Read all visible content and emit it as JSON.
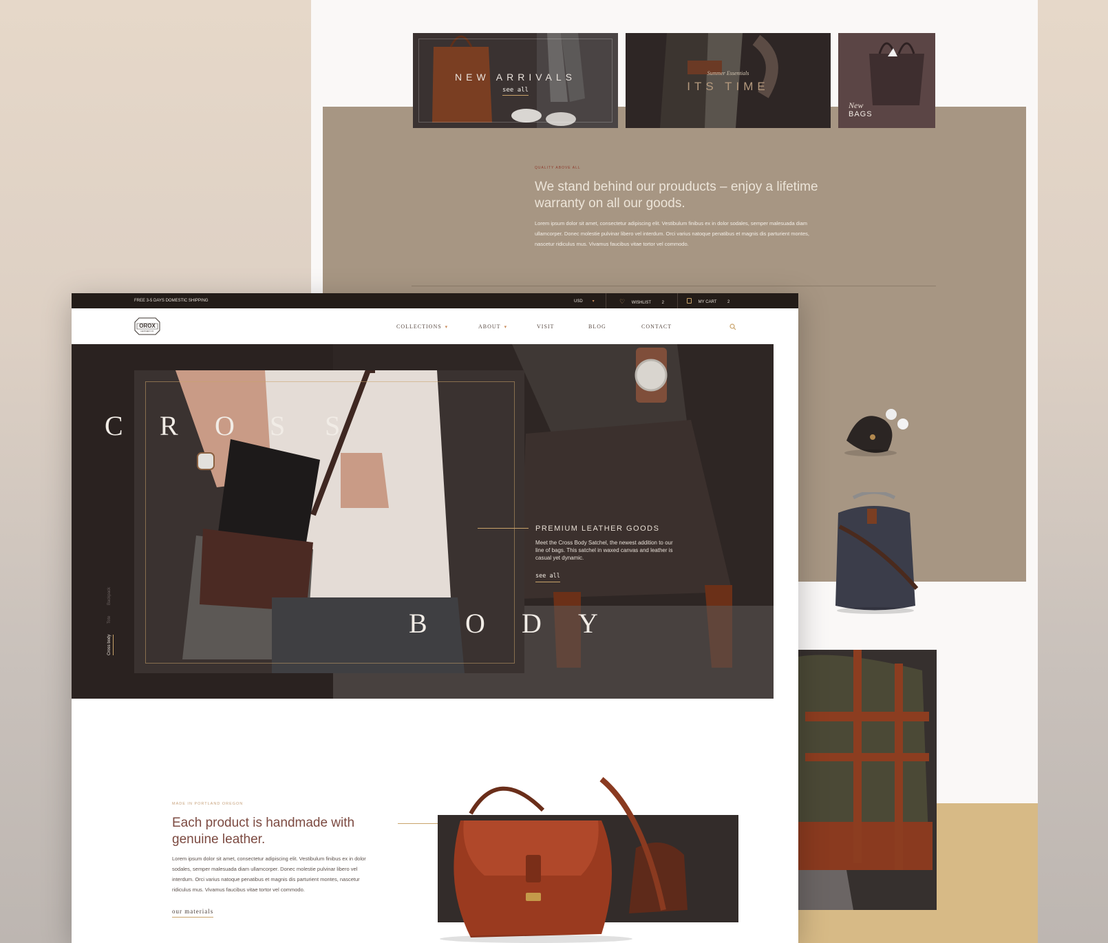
{
  "colors": {
    "accent_gold": "#c9a36a",
    "brand_dark": "#231c18",
    "band_taupe": "#a79683",
    "accent_brown": "#7c4a41"
  },
  "back_page": {
    "tiles": [
      {
        "title": "NEW ARRIVALS",
        "link": "see all"
      },
      {
        "kicker": "Summer Essentials",
        "title": "ITS TIME"
      },
      {
        "kicker": "New",
        "title": "BAGS"
      }
    ],
    "quality": {
      "eyebrow": "QUALITY ABOVE ALL",
      "title": "We stand behind our prouducts – enjoy a lifetime warranty on all our goods.",
      "body": "Lorem ipsum dolor sit amet, consectetur adipiscing elit. Vestibulum finibus ex in dolor sodales, semper malesuada diam ullamcorper. Donec molestie pulvinar libero vel interdum. Orci varius natoque penatibus et magnis dis parturient montes, nascetur ridiculus mus. Vivamus faucibus vitae tortor vel commodo."
    }
  },
  "topbar": {
    "shipping": "FREE 3-5 DAYS DOMESTIC SHIPPING",
    "currency": "USD",
    "wishlist_label": "WISHLIST",
    "wishlist_count": "2",
    "cart_label": "MY CART",
    "cart_count": "2"
  },
  "header": {
    "logo_text": "OROX",
    "logo_sub": "LEATHER CO.",
    "nav": [
      "COLLECTIONS",
      "ABOUT",
      "VISIT",
      "BLOG",
      "CONTACT"
    ]
  },
  "hero": {
    "word_top": [
      "C",
      "R",
      "O",
      "S",
      "S"
    ],
    "word_bottom": [
      "B",
      "O",
      "D",
      "Y"
    ],
    "eyebrow": "PREMIUM LEATHER GOODS",
    "description": "Meet the Cross Body Satchel, the newest addition to our line of bags. This satchel in waxed canvas and leather is casual yet dynamic.",
    "link": "see all",
    "side_tabs": [
      "Cross body",
      "Tote",
      "Backpack"
    ]
  },
  "made": {
    "eyebrow": "MADE IN PORTLAND OREGON",
    "title": "Each product is handmade with genuine leather.",
    "body": "Lorem ipsum dolor sit amet, consectetur adipiscing elit. Vestibulum finibus ex in dolor sodales, semper malesuada diam ullamcorper. Donec molestie pulvinar libero vel interdum. Orci varius natoque penatibus et magnis dis parturient montes, nascetur ridiculus mus. Vivamus faucibus vitae tortor vel commodo.",
    "link": "our materials"
  }
}
